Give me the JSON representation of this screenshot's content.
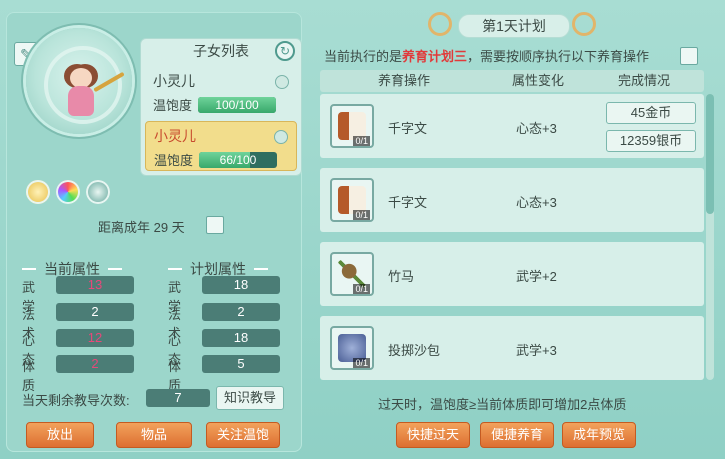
{
  "left": {
    "adult_text": "距离成年 29 天",
    "child_list": {
      "title": "子女列表",
      "items": [
        {
          "name": "小灵儿",
          "sat_label": "温饱度",
          "sat_text": "100/100",
          "sat_fraction": 1.0,
          "selected": false
        },
        {
          "name": "小灵儿",
          "sat_label": "温饱度",
          "sat_text": "66/100",
          "sat_fraction": 0.66,
          "selected": true
        }
      ]
    },
    "current_attrs": {
      "title": "当前属性",
      "rows": [
        {
          "label": "武学",
          "value": "13"
        },
        {
          "label": "法术",
          "value": "2"
        },
        {
          "label": "心态",
          "value": "12"
        },
        {
          "label": "体质",
          "value": "2"
        }
      ]
    },
    "plan_attrs": {
      "title": "计划属性",
      "rows": [
        {
          "label": "武学",
          "value": "18"
        },
        {
          "label": "法术",
          "value": "2"
        },
        {
          "label": "心态",
          "value": "18"
        },
        {
          "label": "体质",
          "value": "5"
        }
      ]
    },
    "teach": {
      "label": "当天剩余教导次数:",
      "value": "7",
      "button": "知识教导"
    },
    "buttons": {
      "release": "放出",
      "items": "物品",
      "care": "关注温饱"
    }
  },
  "right": {
    "day_title": "第1天计划",
    "desc_prefix": "当前执行的是",
    "desc_plan": "养育计划三",
    "desc_suffix": "，需要按顺序执行以下养育操作",
    "columns": [
      "养育操作",
      "属性变化",
      "完成情况"
    ],
    "rows": [
      {
        "count": "0/1",
        "name": "千字文",
        "change": "心态+3",
        "icon": "book-icon",
        "rewards": [
          "45金币",
          "12359银币"
        ]
      },
      {
        "count": "0/1",
        "name": "千字文",
        "change": "心态+3",
        "icon": "book-icon",
        "rewards": []
      },
      {
        "count": "0/1",
        "name": "竹马",
        "change": "武学+2",
        "icon": "hobbyhorse-icon",
        "rewards": []
      },
      {
        "count": "0/1",
        "name": "投掷沙包",
        "change": "武学+3",
        "icon": "sandbag-icon",
        "rewards": []
      }
    ],
    "tip": "过天时，温饱度≥当前体质即可增加2点体质",
    "buttons": {
      "skip_day": "快捷过天",
      "quick_raise": "便捷养育",
      "adult_preview": "成年预览"
    }
  }
}
